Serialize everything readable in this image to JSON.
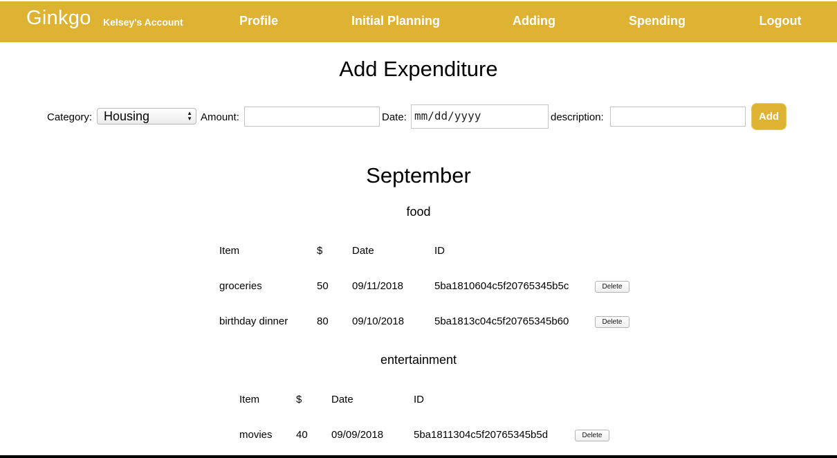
{
  "header": {
    "brand": "Ginkgo",
    "account": "Kelsey's Account",
    "nav": [
      "Profile",
      "Initial Planning",
      "Adding",
      "Spending",
      "Logout"
    ],
    "bar_color": "#deb232"
  },
  "form": {
    "title": "Add Expenditure",
    "category_label": "Category:",
    "category_value": "Housing",
    "amount_label": "Amount:",
    "amount_value": "",
    "date_label": "Date:",
    "date_placeholder": "mm/dd/yyyy",
    "description_label": "description:",
    "description_value": "",
    "add_label": "Add"
  },
  "month": "September",
  "table_headers": {
    "item": "Item",
    "amount": "$",
    "date": "Date",
    "id": "ID"
  },
  "delete_label": "Delete",
  "groups": [
    {
      "name": "food",
      "rows": [
        {
          "item": "groceries",
          "amount": "50",
          "date": "09/11/2018",
          "id": "5ba1810604c5f20765345b5c"
        },
        {
          "item": "birthday dinner",
          "amount": "80",
          "date": "09/10/2018",
          "id": "5ba1813c04c5f20765345b60"
        }
      ]
    },
    {
      "name": "entertainment",
      "rows": [
        {
          "item": "movies",
          "amount": "40",
          "date": "09/09/2018",
          "id": "5ba1811304c5f20765345b5d"
        }
      ]
    }
  ]
}
